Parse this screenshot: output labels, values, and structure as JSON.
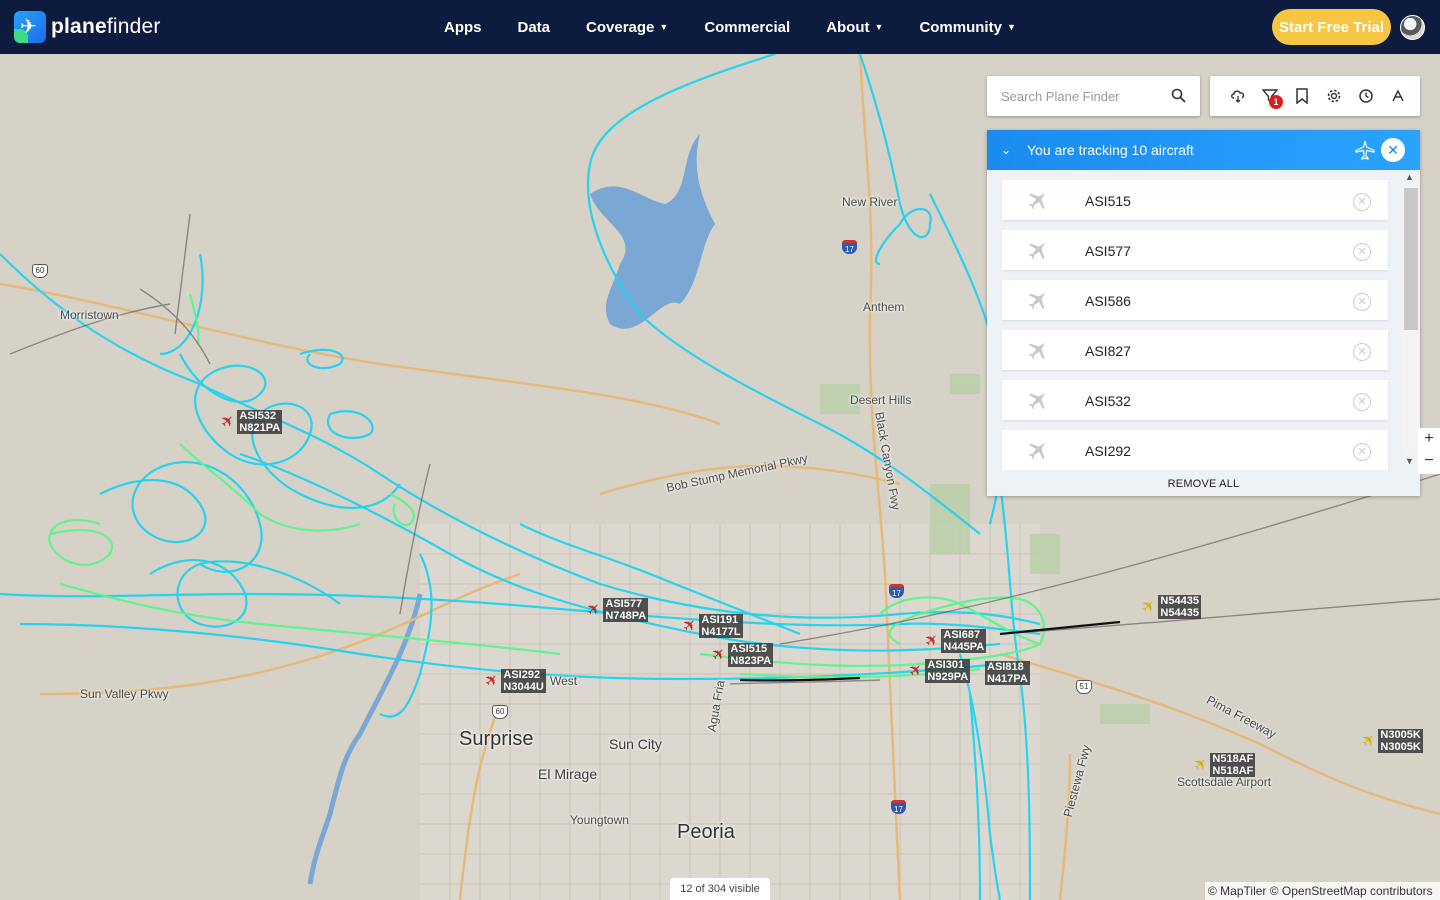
{
  "brand": {
    "name_bold": "plane",
    "name_rest": "finder"
  },
  "nav": [
    {
      "label": "Apps",
      "dropdown": false
    },
    {
      "label": "Data",
      "dropdown": false
    },
    {
      "label": "Coverage",
      "dropdown": true
    },
    {
      "label": "Commercial",
      "dropdown": false
    },
    {
      "label": "About",
      "dropdown": true
    },
    {
      "label": "Community",
      "dropdown": true
    }
  ],
  "cta": {
    "label": "Start Free Trial"
  },
  "search": {
    "placeholder": "Search Plane Finder"
  },
  "toolbar": {
    "filter_badge": "1"
  },
  "tracking": {
    "title": "You are tracking 10 aircraft",
    "items": [
      "ASI515",
      "ASI577",
      "ASI586",
      "ASI827",
      "ASI532",
      "ASI292"
    ],
    "remove_all": "REMOVE ALL"
  },
  "zoom": {
    "in": "+",
    "out": "−"
  },
  "status": {
    "visible": "12 of 304 visible"
  },
  "attribution": "© MapTiler © OpenStreetMap contributors",
  "places": {
    "new_river": "New River",
    "anthem": "Anthem",
    "desert_hills": "Desert Hills",
    "morristown": "Morristown",
    "surprise": "Surprise",
    "sun_city": "Sun City",
    "el_mirage": "El Mirage",
    "youngtown": "Youngtown",
    "peoria": "Peoria",
    "scottsdale_airport": "Scottsdale Airport",
    "sun_valley_pkwy": "Sun Valley Pkwy",
    "bob_stump": "Bob Stump Memorial Pkwy",
    "black_canyon": "Black Canyon Fwy",
    "pima_fwy": "Pima Freeway",
    "piestewa": "Piestewa Fwy",
    "agua_fria": "Agua Fria",
    "west": "West"
  },
  "aircraft": [
    {
      "callsign": "ASI532",
      "reg": "N821PA",
      "color": "#c62828"
    },
    {
      "callsign": "ASI577",
      "reg": "N748PA",
      "color": "#c62828"
    },
    {
      "callsign": "ASI191",
      "reg": "N4177L",
      "color": "#c62828"
    },
    {
      "callsign": "ASI515",
      "reg": "N823PA",
      "color": "#c62828"
    },
    {
      "callsign": "ASI292",
      "reg": "N3044U",
      "color": "#c62828"
    },
    {
      "callsign": "ASI687",
      "reg": "N445PA",
      "color": "#c62828"
    },
    {
      "callsign": "ASI301",
      "reg": "N929PA",
      "color": "#c62828"
    },
    {
      "callsign": "ASI818",
      "reg": "N417PA",
      "color": "#c62828"
    },
    {
      "callsign": "N54435",
      "reg": "N54435",
      "color": "#d9b400"
    },
    {
      "callsign": "N518AF",
      "reg": "N518AF",
      "color": "#d9b400"
    },
    {
      "callsign": "N3005K",
      "reg": "N3005K",
      "color": "#d9b400"
    }
  ],
  "colors": {
    "nav_bg": "#0d1b3e",
    "cta": "#f6c542",
    "track_blue": "#1fd3f0",
    "track_green": "#5cf58a",
    "panel_header": "#1a8cf0"
  }
}
